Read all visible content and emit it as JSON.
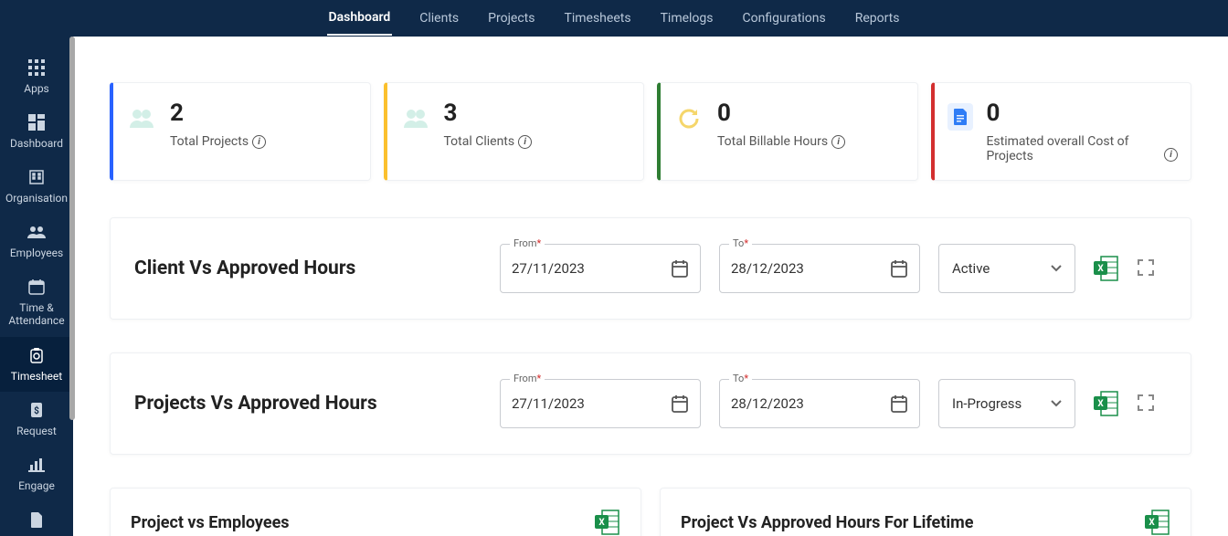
{
  "topnav": {
    "items": [
      "Dashboard",
      "Clients",
      "Projects",
      "Timesheets",
      "Timelogs",
      "Configurations",
      "Reports"
    ],
    "active_index": 0
  },
  "sidebar": {
    "items": [
      {
        "label": "Apps"
      },
      {
        "label": "Dashboard"
      },
      {
        "label": "Organisation"
      },
      {
        "label": "Employees"
      },
      {
        "label": "Time & Attendance"
      },
      {
        "label": "Timesheet"
      },
      {
        "label": "Request"
      },
      {
        "label": "Engage"
      },
      {
        "label": ""
      }
    ],
    "active_index": 5
  },
  "cards": [
    {
      "value": "2",
      "label": "Total Projects",
      "info": true
    },
    {
      "value": "3",
      "label": "Total Clients",
      "info": true
    },
    {
      "value": "0",
      "label": "Total Billable Hours",
      "info": true
    },
    {
      "value": "0",
      "label": "Estimated overall Cost of Projects",
      "info_float": true
    }
  ],
  "panels": [
    {
      "title": "Client Vs Approved Hours",
      "from_label": "From",
      "from_value": "27/11/2023",
      "to_label": "To",
      "to_value": "28/12/2023",
      "status": "Active"
    },
    {
      "title": "Projects Vs Approved Hours",
      "from_label": "From",
      "from_value": "27/11/2023",
      "to_label": "To",
      "to_value": "28/12/2023",
      "status": "In-Progress"
    }
  ],
  "mini_panels": [
    {
      "title": "Project vs Employees"
    },
    {
      "title": "Project Vs Approved Hours For Lifetime"
    }
  ],
  "required_mark": "*"
}
